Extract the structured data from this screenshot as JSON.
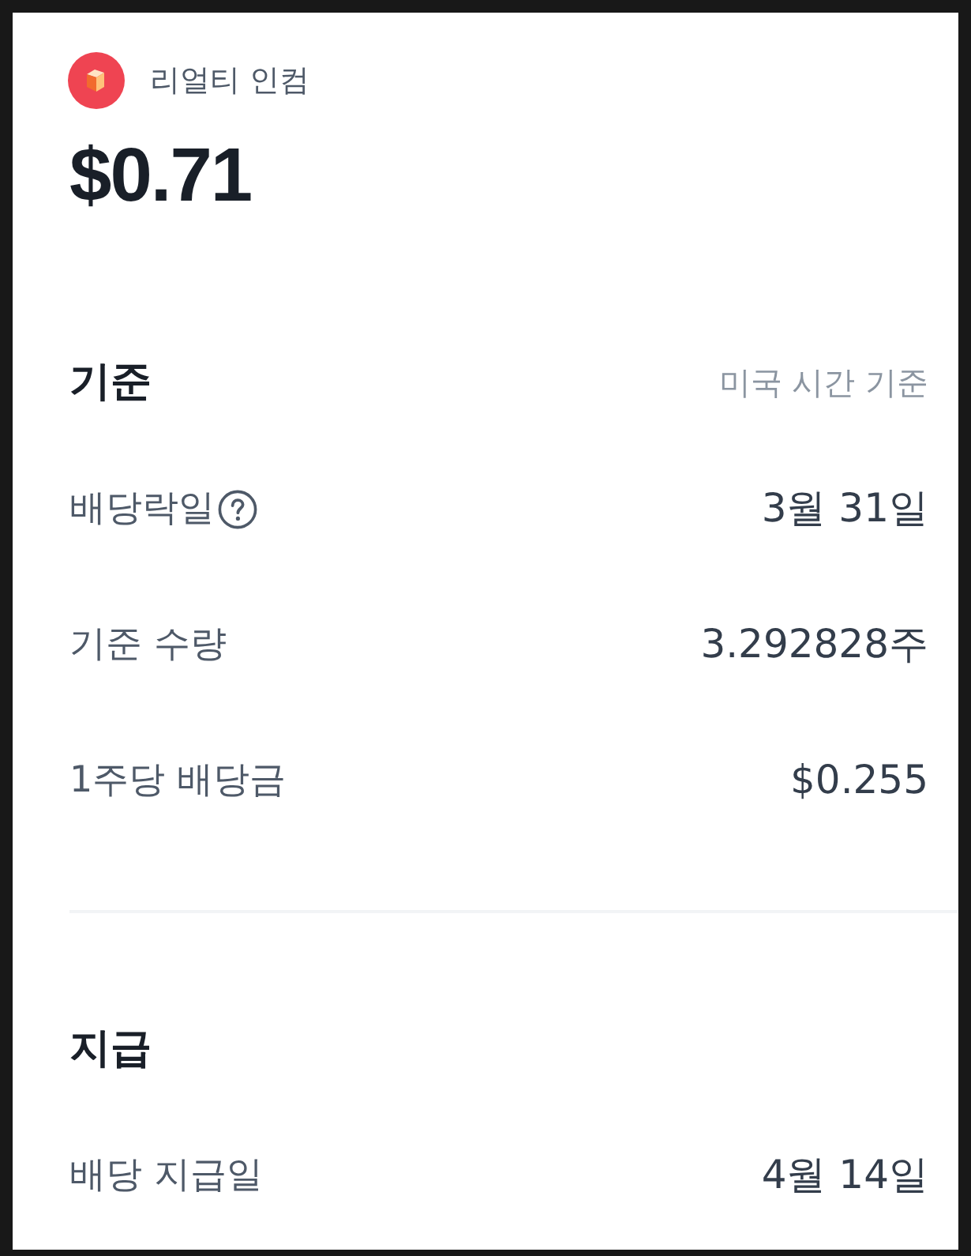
{
  "stock": {
    "name": "리얼티 인컴",
    "amount": "$0.71"
  },
  "sections": [
    {
      "title": "기준",
      "note": "미국 시간 기준",
      "rows": [
        {
          "label": "배당락일",
          "help": true,
          "value": "3월 31일"
        },
        {
          "label": "기준 수량",
          "help": false,
          "value": "3.292828주"
        },
        {
          "label": "1주당 배당금",
          "help": false,
          "value": "$0.255"
        }
      ]
    },
    {
      "title": "지급",
      "rows": [
        {
          "label": "배당 지급일",
          "help": false,
          "value": "4월 14일"
        }
      ]
    }
  ]
}
